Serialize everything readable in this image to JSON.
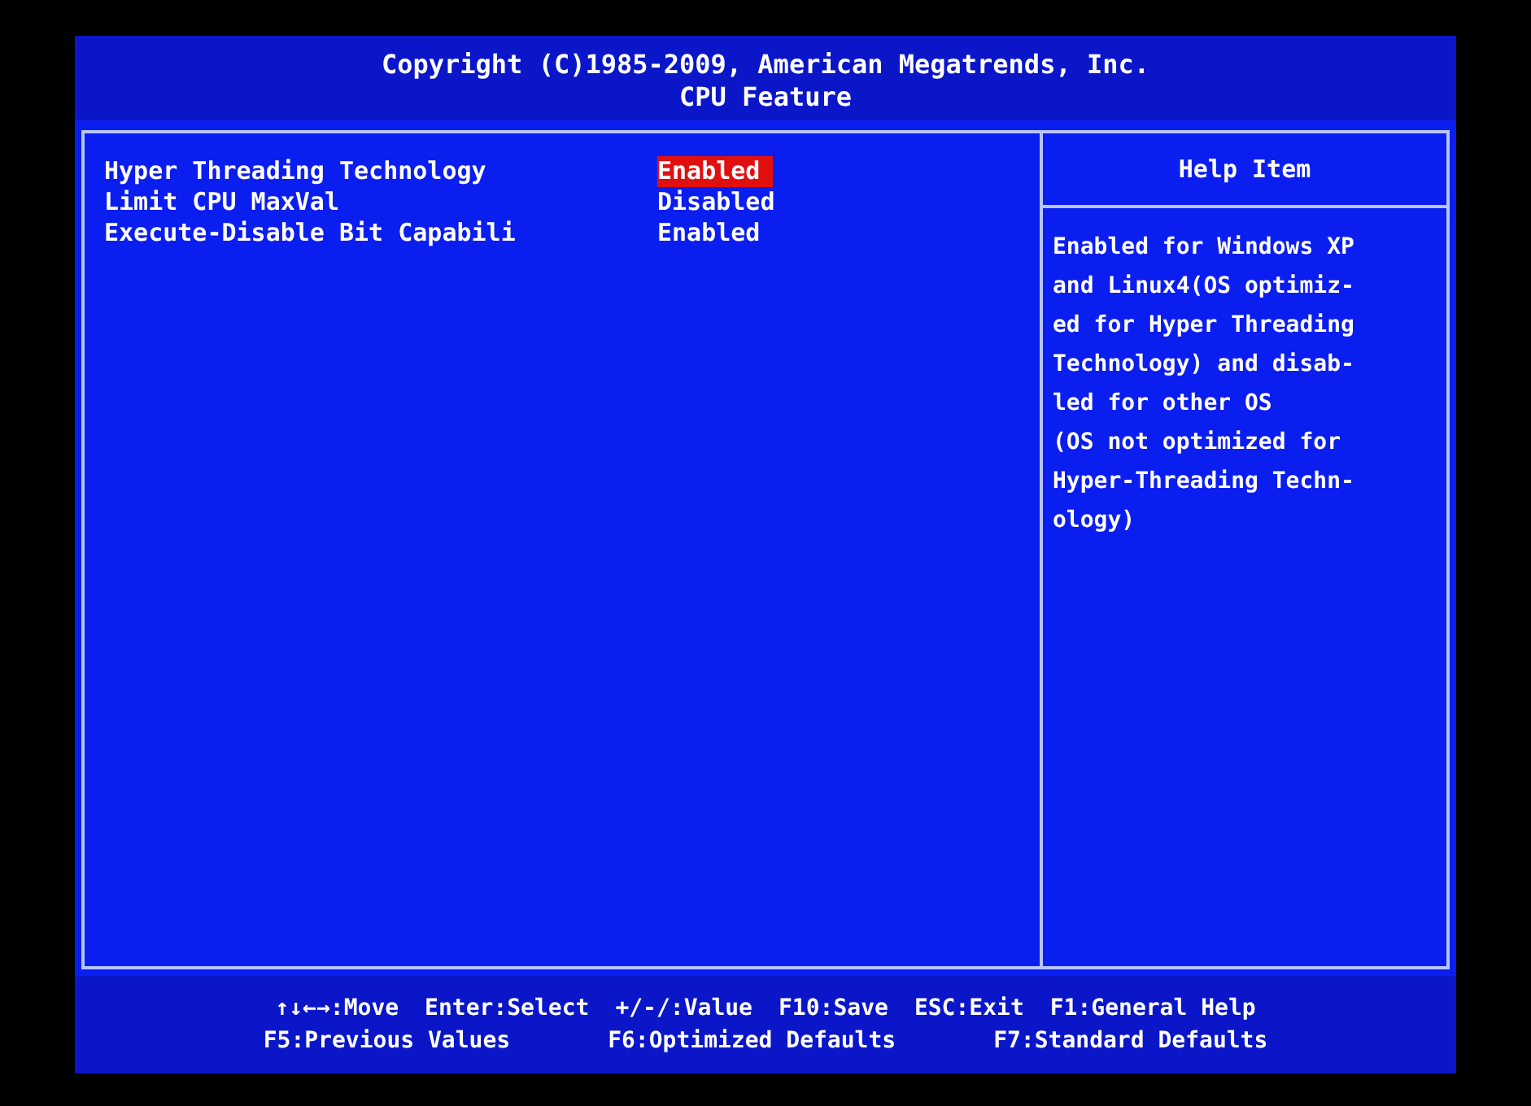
{
  "header": {
    "copyright": "Copyright (C)1985-2009, American Megatrends, Inc.",
    "title": "CPU Feature"
  },
  "settings": [
    {
      "label": "Hyper Threading Technology",
      "value": "Enabled",
      "selected": true
    },
    {
      "label": "Limit CPU MaxVal",
      "value": "Disabled",
      "selected": false
    },
    {
      "label": "Execute-Disable Bit Capabili",
      "value": "Enabled",
      "selected": false
    }
  ],
  "help": {
    "title": "Help Item",
    "lines": [
      "Enabled for Windows XP",
      "and Linux4(OS optimiz-",
      "ed for Hyper Threading",
      "Technology) and disab-",
      "led for other OS",
      "(OS not optimized for",
      "Hyper-Threading Techn-",
      "ology)"
    ]
  },
  "footer": {
    "top_line": {
      "hints": [
        "↑↓←→:Move",
        "Enter:Select",
        "+/-/:Value",
        "F10:Save",
        "ESC:Exit",
        "F1:General Help"
      ]
    },
    "bottom_line": {
      "hints": [
        "F5:Previous Values",
        "F6:Optimized Defaults",
        "F7:Standard Defaults"
      ]
    }
  }
}
